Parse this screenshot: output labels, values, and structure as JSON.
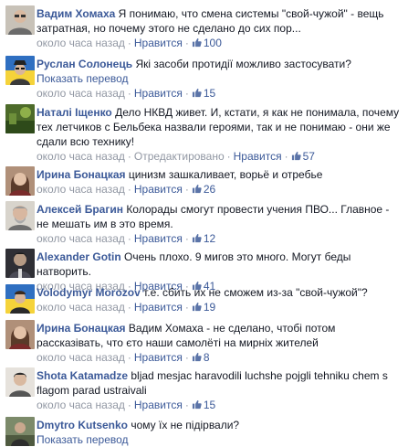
{
  "like_label": "Нравится",
  "time_label": "около часа назад",
  "edited_label": "Отредактировано",
  "translate_label": "Показать перевод",
  "comments": [
    {
      "author": "Вадим Хомаха",
      "text": "Я понимаю, что смена системы \"свой-чужой\" - вещь затратная, но почему этого не сделано до сих пор...",
      "likes": "100",
      "avatar": "avatar-man-glasses"
    },
    {
      "author": "Руслан Солонець",
      "text": "Які засоби протидії можливо застосувати?",
      "likes": "15",
      "avatar": "avatar-ukraine-flag"
    },
    {
      "author": "Наталі Іщенко",
      "text": "Дело НКВД живет. И, кстати, я как не понимала, почему тех летчиков с Бельбека назвали героями, так и не понимаю - они же сдали всю технику!",
      "likes": "57",
      "avatar": "avatar-green-landscape"
    },
    {
      "author": "Ирина Бонацкая",
      "text": "цинизм зашкаливает, ворьё и отребье",
      "likes": "26",
      "avatar": "avatar-woman"
    },
    {
      "author": "Алексей Брагин",
      "text": "Колорады смогут провести учения ПВО... Главное - не мешать им в это время.",
      "likes": "12",
      "avatar": "avatar-man-gray"
    },
    {
      "author": "Alexander Gotin",
      "text": "Очень плохо. 9 мигов это много. Могут беды натворить.",
      "likes": "41",
      "avatar": "avatar-dark-portrait"
    },
    {
      "author": "Volodymyr Morozov",
      "text": "т.е. сбить их не сможем из-за \"свой-чужой\"?",
      "likes": "19",
      "avatar": "avatar-ukraine-flag-2"
    },
    {
      "author": "Ирина Бонацкая",
      "text": "Вадим Хомаха - не сделано, чтобі потом рассказівать, что єто наши самолёті на мирніх жителей",
      "likes": "8",
      "avatar": "avatar-woman"
    },
    {
      "author": "Shota Katamadze",
      "text": "bljad mesjac haravodili luchshe pojgli tehniku chem s flagom parad ustraivali",
      "likes": "15",
      "avatar": "avatar-man-light"
    },
    {
      "author": "Dmytro Kutsenko",
      "text": "чому їх не підірвали?",
      "likes": "",
      "avatar": "avatar-man-outdoor"
    }
  ]
}
